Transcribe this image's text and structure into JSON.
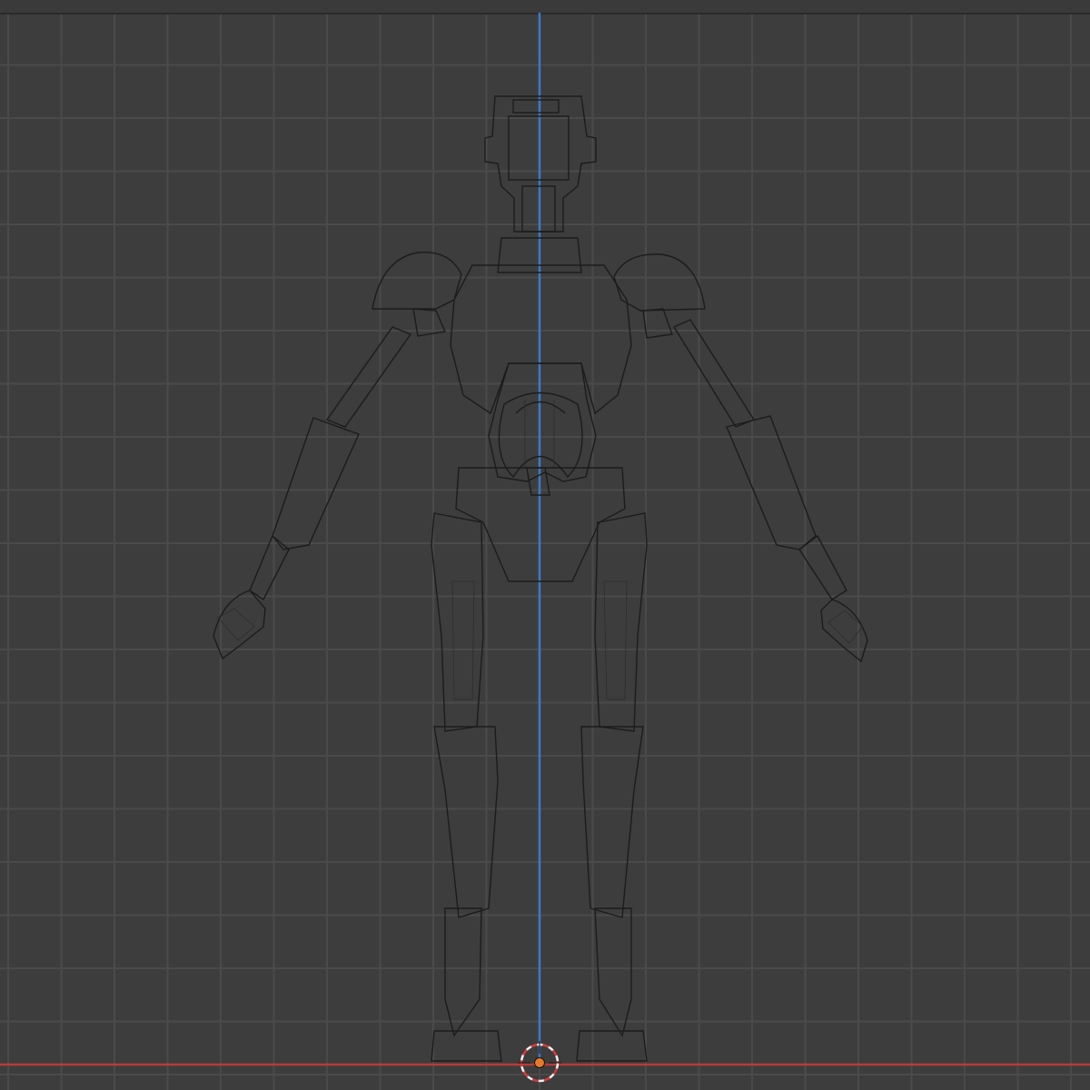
{
  "viewport": {
    "background": "#3d3d3d",
    "grid_color": "#4a4a4a",
    "z_axis_color": "#3f78c8",
    "x_axis_color": "#b83a3a",
    "origin_color": "#e8792a",
    "cursor_color": "#d83a3a"
  },
  "object": {
    "name_icon": "robot-mesh",
    "display": "wireframe-solid"
  },
  "icons": {
    "cursor": "3d-cursor-icon",
    "origin": "origin-icon"
  }
}
